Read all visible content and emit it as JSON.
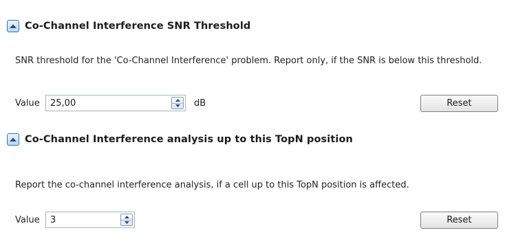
{
  "sections": [
    {
      "title": "Co-Channel Interference SNR Threshold",
      "description": "SNR threshold for the 'Co-Channel Interference' problem. Report only, if the SNR is below this threshold.",
      "value_label": "Value",
      "value": "25,00",
      "unit": "dB",
      "reset_label": "Reset"
    },
    {
      "title": "Co-Channel Interference analysis up to this TopN position",
      "description": "Report the co-channel interference analysis, if a cell up to this TopN position is affected.",
      "value_label": "Value",
      "value": "3",
      "reset_label": "Reset"
    }
  ],
  "icons": {
    "collapse": "chevron-up-icon",
    "spin_up": "arrow-up-icon",
    "spin_down": "arrow-down-icon"
  },
  "colors": {
    "collapse_border": "#2f73b6",
    "collapse_fill": "#b9d8f6",
    "arrow": "#1f4f86"
  }
}
